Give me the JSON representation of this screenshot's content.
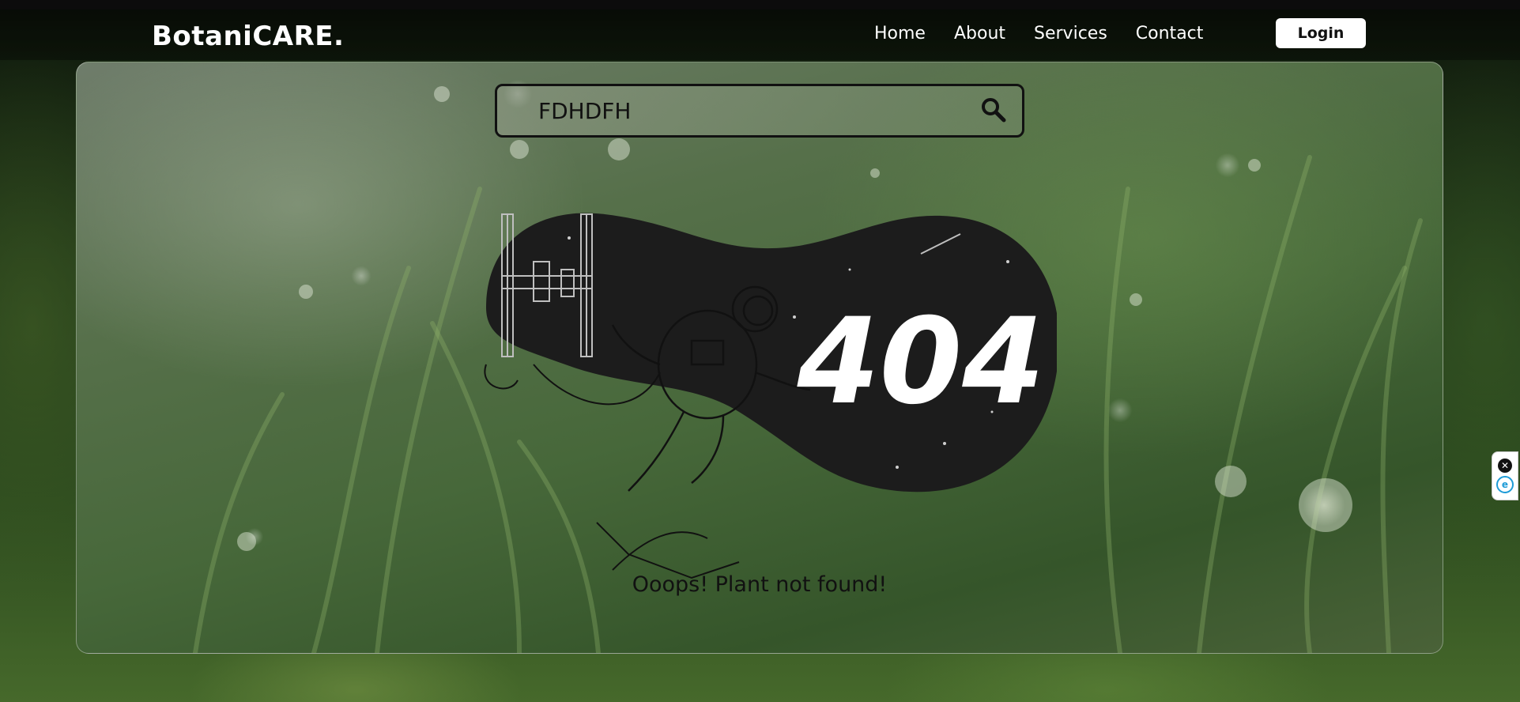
{
  "header": {
    "logo": "BotaniCARE.",
    "nav": [
      {
        "label": "Home"
      },
      {
        "label": "About"
      },
      {
        "label": "Services"
      },
      {
        "label": "Contact"
      }
    ],
    "login_label": "Login"
  },
  "search": {
    "value": "FDHDFH"
  },
  "error": {
    "code": "404",
    "message": "Ooops! Plant not found!"
  },
  "side_widget": {
    "close_glyph": "✕",
    "extension_glyph": "e"
  },
  "colors": {
    "nav_text": "#ffffff",
    "login_bg": "#ffffff",
    "dark_blob": "#1c1c1c",
    "message_text": "#111111"
  },
  "icons": {
    "search": "search-icon",
    "close": "close-icon",
    "extension": "extension-icon"
  }
}
